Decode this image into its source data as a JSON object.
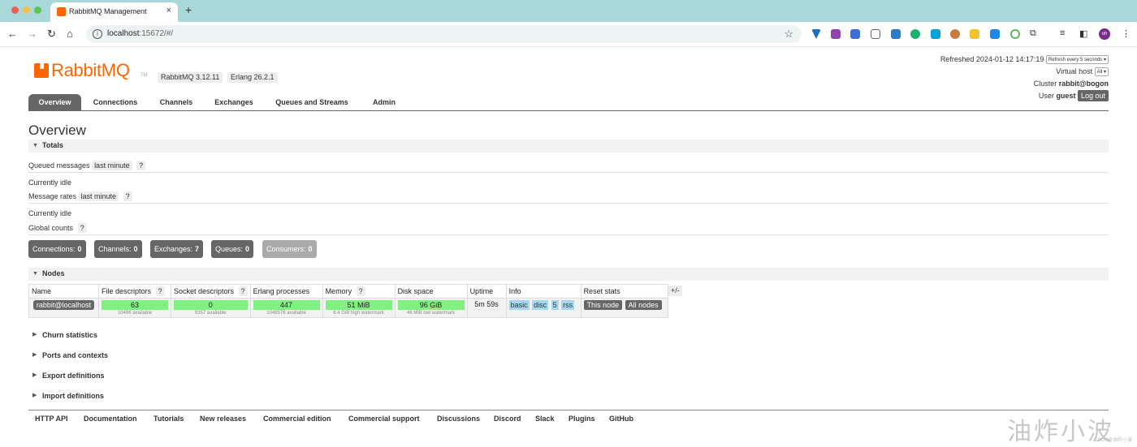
{
  "browser": {
    "tab_title": "RabbitMQ Management",
    "tab_close": "×",
    "new_tab": "+",
    "url_host": "localhost",
    "url_rest": ":15672/#/",
    "profile_initials": "oh"
  },
  "header": {
    "logo_rabbit": "RabbitMQ",
    "logo_tm": "TM",
    "version": "RabbitMQ 3.12.11",
    "erlang": "Erlang 26.2.1",
    "refreshed_label": "Refreshed 2024-01-12 14:17:19",
    "refresh_select": "Refresh every 5 seconds",
    "vhost_label": "Virtual host",
    "vhost_select": "All",
    "cluster_label": "Cluster",
    "cluster_value": "rabbit@bogon",
    "user_label": "User",
    "user_value": "guest",
    "logout_label": "Log out"
  },
  "nav": {
    "tabs": [
      "Overview",
      "Connections",
      "Channels",
      "Exchanges",
      "Queues and Streams",
      "Admin"
    ],
    "active": "Overview"
  },
  "overview": {
    "title": "Overview",
    "totals_label": "Totals",
    "queued_label": "Queued messages",
    "queued_range": "last minute",
    "help": "?",
    "idle1": "Currently idle",
    "rates_label": "Message rates",
    "rates_range": "last minute",
    "idle2": "Currently idle",
    "global_label": "Global counts",
    "counts": [
      {
        "label": "Connections:",
        "value": "0"
      },
      {
        "label": "Channels:",
        "value": "0"
      },
      {
        "label": "Exchanges:",
        "value": "7"
      },
      {
        "label": "Queues:",
        "value": "0"
      },
      {
        "label": "Consumers:",
        "value": "0"
      }
    ]
  },
  "nodes": {
    "label": "Nodes",
    "plusminus": "+/-",
    "headers": [
      "Name",
      "File descriptors",
      "Socket descriptors",
      "Erlang processes",
      "Memory",
      "Disk space",
      "Uptime",
      "Info",
      "Reset stats"
    ],
    "row": {
      "name": "rabbit@localhost",
      "fd": "63",
      "fd_sub": "10496 available",
      "sd": "0",
      "sd_sub": "9357 available",
      "ep": "447",
      "ep_sub": "1048576 available",
      "mem": "51 MiB",
      "mem_sub": "6.4 GiB high watermark",
      "disk": "96 GiB",
      "disk_sub": "48 MiB low watermark",
      "uptime": "5m 59s",
      "info": [
        "basic",
        "disc",
        "5",
        "rss"
      ],
      "reset_this": "This node",
      "reset_all": "All nodes"
    }
  },
  "collapsed_sections": [
    "Churn statistics",
    "Ports and contexts",
    "Export definitions",
    "Import definitions"
  ],
  "footer": [
    "HTTP API",
    "Documentation",
    "Tutorials",
    "New releases",
    "Commercial edition",
    "Commercial support",
    "Discussions",
    "Discord",
    "Slack",
    "Plugins",
    "GitHub"
  ],
  "watermark": "油炸小波",
  "watermark_sub": "CSDN@油炸小波"
}
